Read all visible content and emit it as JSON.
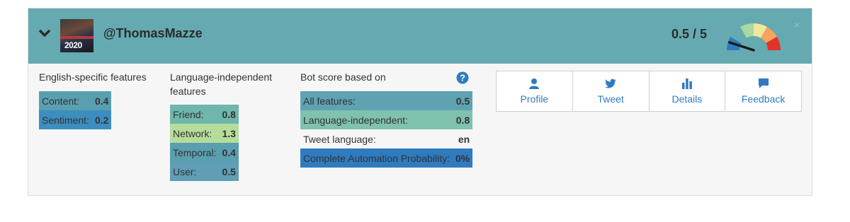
{
  "header": {
    "username": "@ThomasMazze",
    "avatar_text": "2020",
    "score_text": "0.5 / 5",
    "close_glyph": "×",
    "colors": {
      "header_bg": "#65aab1",
      "needle": "#1a1a1a"
    }
  },
  "gauge": {
    "score": 0.5,
    "max": 5,
    "segment_colors": [
      "#2f7bbf",
      "#65aab1",
      "#a9d8a0",
      "#f1e79a",
      "#f5a460",
      "#e0342a"
    ]
  },
  "english_features": {
    "title": "English-specific features",
    "rows": [
      {
        "label": "Content:",
        "value": "0.4",
        "color": "#5a9fb0"
      },
      {
        "label": "Sentiment:",
        "value": "0.2",
        "color": "#3c8dc0"
      }
    ]
  },
  "language_independent": {
    "title_line1": "Language-independent",
    "title_line2": "features",
    "rows": [
      {
        "label": "Friend:",
        "value": "0.8",
        "color": "#6fb6ad"
      },
      {
        "label": "Network:",
        "value": "1.3",
        "color": "#b6dc9b"
      },
      {
        "label": "Temporal:",
        "value": "0.4",
        "color": "#5a9fb0"
      },
      {
        "label": "User:",
        "value": "0.5",
        "color": "#5f9eb4"
      }
    ]
  },
  "bot_score": {
    "title": "Bot score based on",
    "rows": [
      {
        "label": "All features:",
        "value": "0.5",
        "color": "#5fa2b2"
      },
      {
        "label": "Language-independent:",
        "value": "0.8",
        "color": "#80c1b0"
      },
      {
        "label": "Tweet language:",
        "value": "en",
        "color": "transparent"
      },
      {
        "label": "Complete Automation Probability:",
        "value": "0%",
        "color": "#2f7bbf"
      }
    ]
  },
  "actions": {
    "profile": "Profile",
    "tweet": "Tweet",
    "details": "Details",
    "feedback": "Feedback",
    "icon_color": "#2f7bbf"
  }
}
